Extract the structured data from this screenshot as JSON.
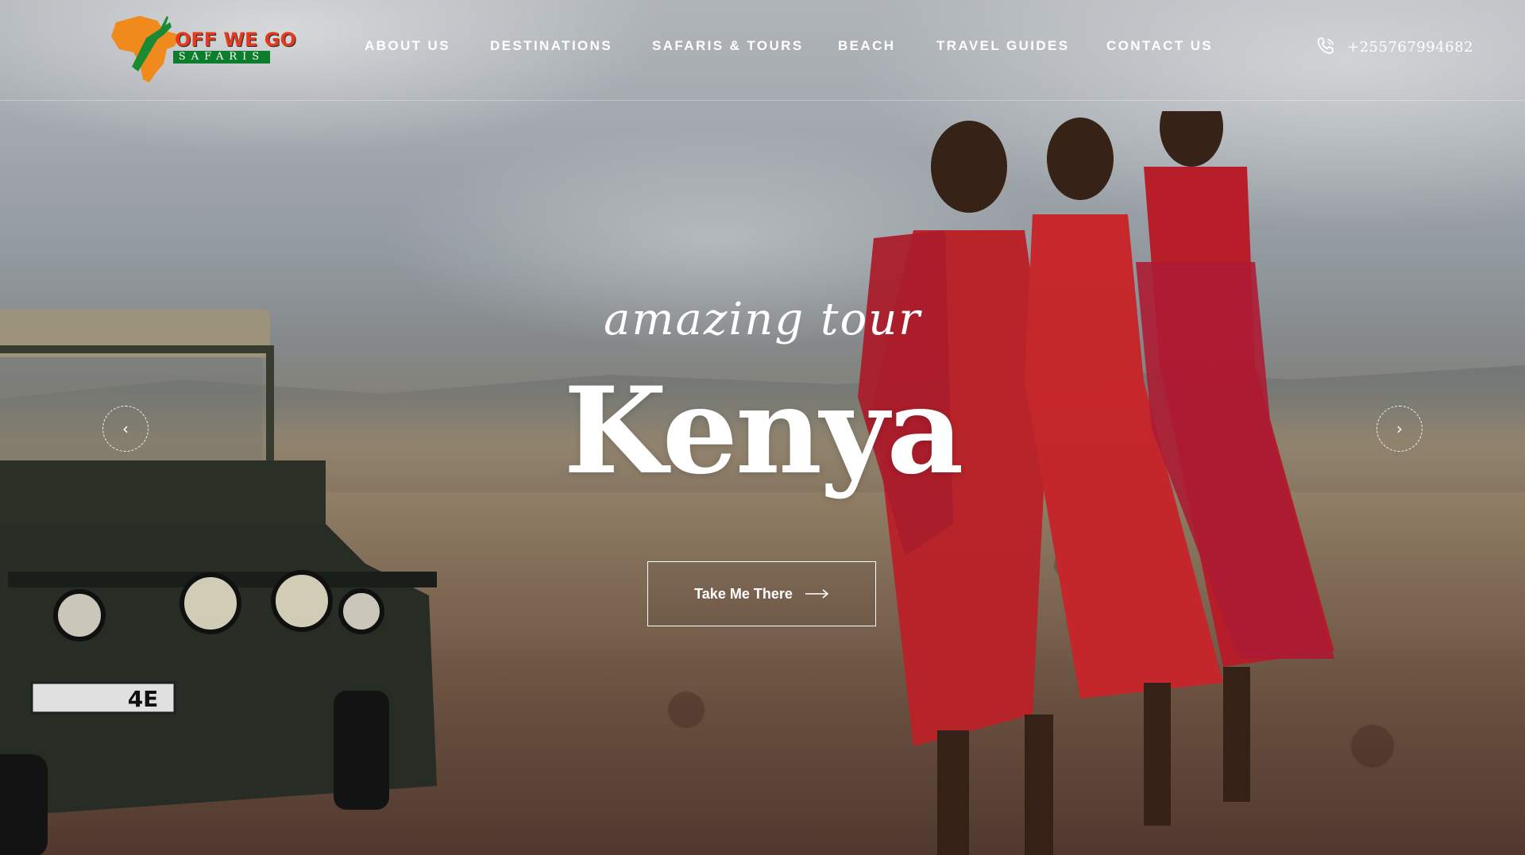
{
  "brand": {
    "logo_line_1": "OFF WE GO",
    "logo_line_2": "SAFARIS",
    "logo_colors": {
      "africa": "#f08a1c",
      "text": "#e43b1e",
      "banner": "#0c7d2d"
    }
  },
  "nav": {
    "items": [
      {
        "label": "ABOUT US"
      },
      {
        "label": "DESTINATIONS"
      },
      {
        "label": "SAFARIS & TOURS"
      },
      {
        "label": "BEACH"
      },
      {
        "label": "TRAVEL GUIDES"
      },
      {
        "label": "CONTACT US"
      }
    ]
  },
  "contact": {
    "phone_icon": "phone-icon",
    "phone": "+255767994682"
  },
  "hero": {
    "subtitle": "amazing tour",
    "title": "Kenya",
    "cta_label": "Take Me There",
    "cta_icon": "arrow-right-icon",
    "prev_icon": "chevron-left-icon",
    "next_icon": "chevron-right-icon",
    "prev_glyph": "‹",
    "next_glyph": "›"
  },
  "scene": {
    "vehicle_plate": "4E"
  }
}
